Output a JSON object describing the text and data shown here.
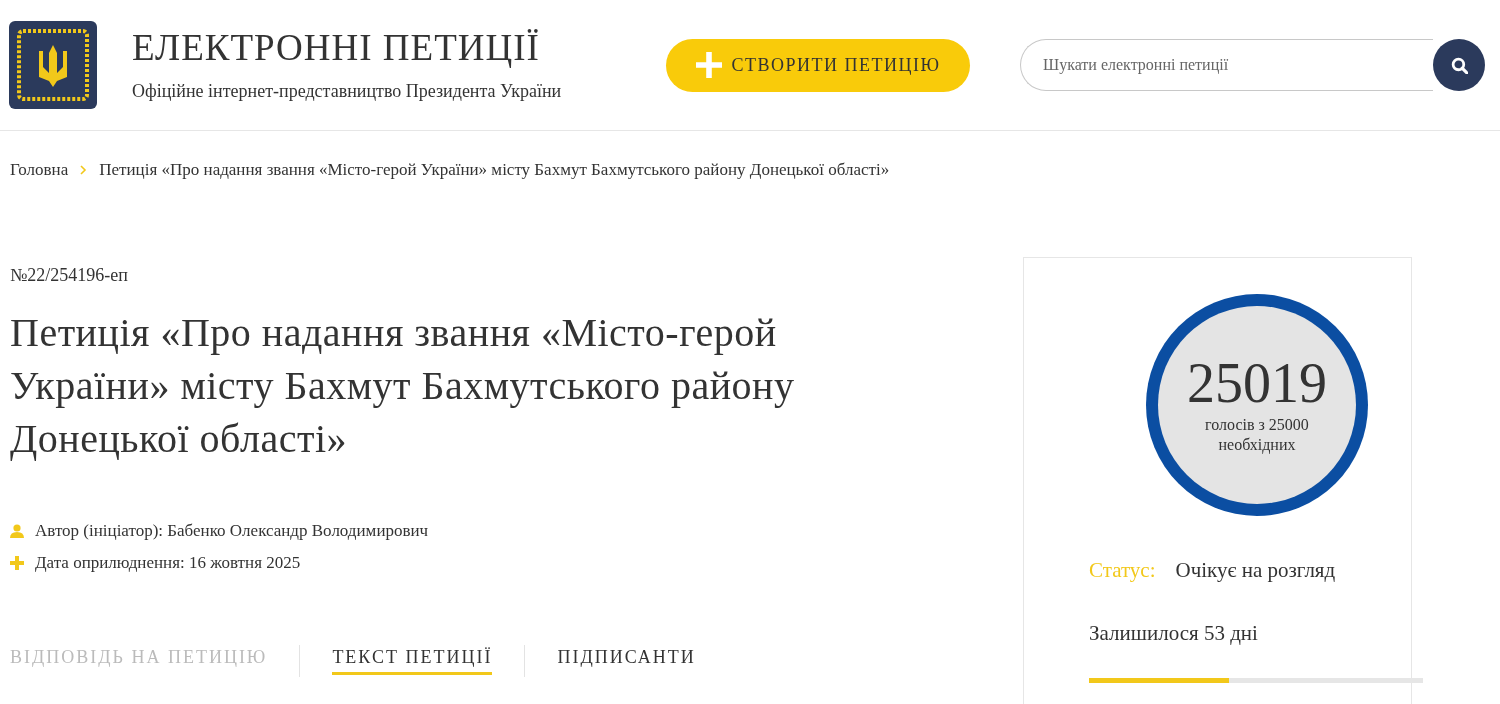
{
  "header": {
    "title": "ЕЛЕКТРОННІ ПЕТИЦІЇ",
    "subtitle": "Офіційне інтернет-представництво Президента України",
    "create_button": "СТВОРИТИ ПЕТИЦІЮ",
    "search": {
      "placeholder": "Шукати електронні петиції"
    }
  },
  "breadcrumbs": [
    "Головна",
    "Петиція «Про надання звання «Місто-герой України» місту Бахмут Бахмутського району Донецької області»"
  ],
  "petition": {
    "number": "№22/254196-еп",
    "title": "Петиція «Про надання звання «Місто-герой України» місту Бахмут Бахмутського району Донецької області»",
    "meta": [
      {
        "kind": "author",
        "text": "Автор (ініціатор): Бабенко Олександр Володимирович"
      },
      {
        "kind": "date",
        "text": "Дата оприлюднення: 16 жовтня 2025"
      }
    ],
    "tabs": [
      {
        "label": "ВІДПОВІДЬ НА ПЕТИЦІЮ",
        "selected": false,
        "disabled": true
      },
      {
        "label": "ТЕКСТ ПЕТИЦІЇ",
        "selected": true,
        "disabled": false
      },
      {
        "label": "ПІДПИСАНТИ",
        "selected": false,
        "disabled": false
      }
    ]
  },
  "votes": {
    "count": "25019",
    "caption": "голосів з 25000 необхідних",
    "status_label": "Статус:",
    "status": "Очікує на розгляд",
    "remaining": "Залишилося 53 дні",
    "time": {
      "level": 0.42
    }
  }
}
